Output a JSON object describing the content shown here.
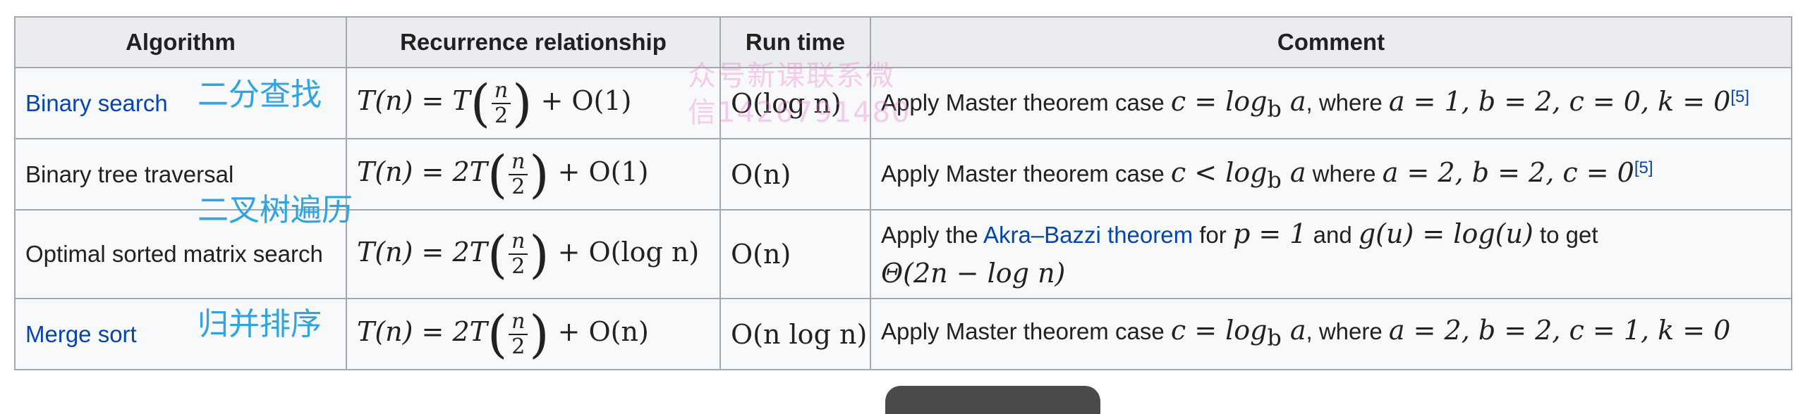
{
  "headers": [
    "Algorithm",
    "Recurrence relationship",
    "Run time",
    "Comment"
  ],
  "rows": [
    {
      "algorithm": "Binary search",
      "zh_label": "二分查找",
      "rec_lhs": "T(n) = T",
      "rec_num": "n",
      "rec_den": "2",
      "rec_rhs": "+ O(1)",
      "runtime": "O(log n)",
      "comment_a": "Apply Master theorem case",
      "comment_m1": "c = log",
      "comment_sub": "b",
      "comment_m1b": " a",
      "comment_b": ", where",
      "comment_m2": "a = 1, b = 2, c = 0, k = 0",
      "ref": "[5]"
    },
    {
      "algorithm": "Binary tree traversal",
      "zh_label": "二叉树遍历",
      "rec_lhs": "T(n) = 2T",
      "rec_num": "n",
      "rec_den": "2",
      "rec_rhs": "+ O(1)",
      "runtime": "O(n)",
      "comment_a": "Apply Master theorem case",
      "comment_m1": "c < log",
      "comment_sub": "b",
      "comment_m1b": " a",
      "comment_b": "where",
      "comment_m2": "a = 2, b = 2, c = 0",
      "ref": "[5]"
    },
    {
      "algorithm": "Optimal sorted matrix search",
      "rec_lhs": "T(n) = 2T",
      "rec_num": "n",
      "rec_den": "2",
      "rec_rhs": "+ O(log n)",
      "runtime": "O(n)",
      "comment_a": "Apply the",
      "comment_link": "Akra–Bazzi theorem",
      "comment_b": "for",
      "comment_m1": "p = 1",
      "comment_c": "and",
      "comment_m2": "g(u) = log(u)",
      "comment_d": "to get",
      "comment_m3": "Θ(2n − log n)"
    },
    {
      "algorithm": "Merge sort",
      "zh_label": "归并排序",
      "rec_lhs": "T(n) = 2T",
      "rec_num": "n",
      "rec_den": "2",
      "rec_rhs": "+ O(n)",
      "runtime": "O(n log n)",
      "comment_a": "Apply Master theorem case",
      "comment_m1": "c = log",
      "comment_sub": "b",
      "comment_m1b": " a",
      "comment_b": ", where",
      "comment_m2": "a = 2, b = 2, c = 1, k = 0"
    }
  ],
  "watermark_line1": "众号新课联系微",
  "watermark_line2": "信1426791480"
}
